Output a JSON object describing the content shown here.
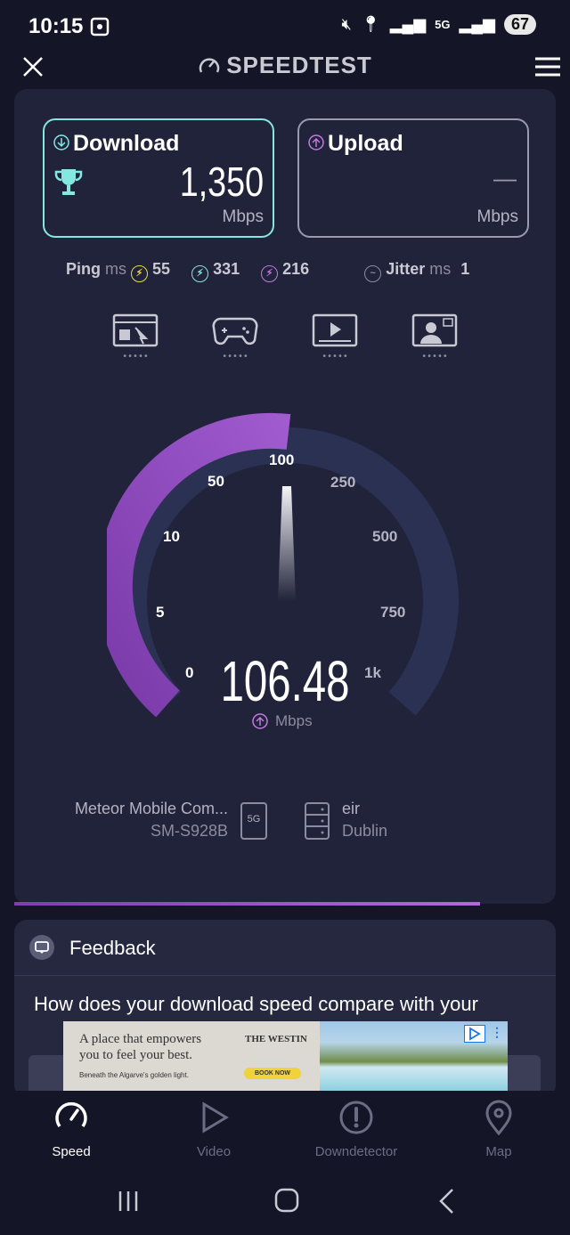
{
  "status_bar": {
    "time": "10:15",
    "battery": "67",
    "signal_label": "5G"
  },
  "app_bar": {
    "title": "SPEEDTEST"
  },
  "download": {
    "label": "Download",
    "value": "1,350",
    "unit": "Mbps"
  },
  "upload": {
    "label": "Upload",
    "value": "—",
    "unit": "Mbps"
  },
  "metrics": {
    "ping_label": "Ping",
    "ping_unit": "ms",
    "ping_idle": "55",
    "ping_download": "331",
    "ping_upload": "216",
    "jitter_label": "Jitter",
    "jitter_unit": "ms",
    "jitter_value": "1"
  },
  "gauge": {
    "ticks": [
      "0",
      "5",
      "10",
      "50",
      "100",
      "250",
      "500",
      "750",
      "1k"
    ],
    "value": "106.48",
    "unit": "Mbps",
    "colors": {
      "filled": "#8e44b6",
      "track": "#2a3152",
      "needle": "#e8e8ef"
    }
  },
  "connection": {
    "provider": "Meteor Mobile Com...",
    "device": "SM-S928B",
    "network_badge": "5G",
    "server_name": "eir",
    "server_location": "Dublin"
  },
  "feedback": {
    "title": "Feedback",
    "question": "How does your download speed compare with your"
  },
  "ad": {
    "line1": "A place that empowers",
    "line2": "you to feel your best.",
    "line3": "Beneath the Algarve's golden light.",
    "brand": "THE WESTIN",
    "cta": "BOOK NOW"
  },
  "tabs": [
    {
      "label": "Speed",
      "active": true
    },
    {
      "label": "Video",
      "active": false
    },
    {
      "label": "Downdetector",
      "active": false
    },
    {
      "label": "Map",
      "active": false
    }
  ]
}
